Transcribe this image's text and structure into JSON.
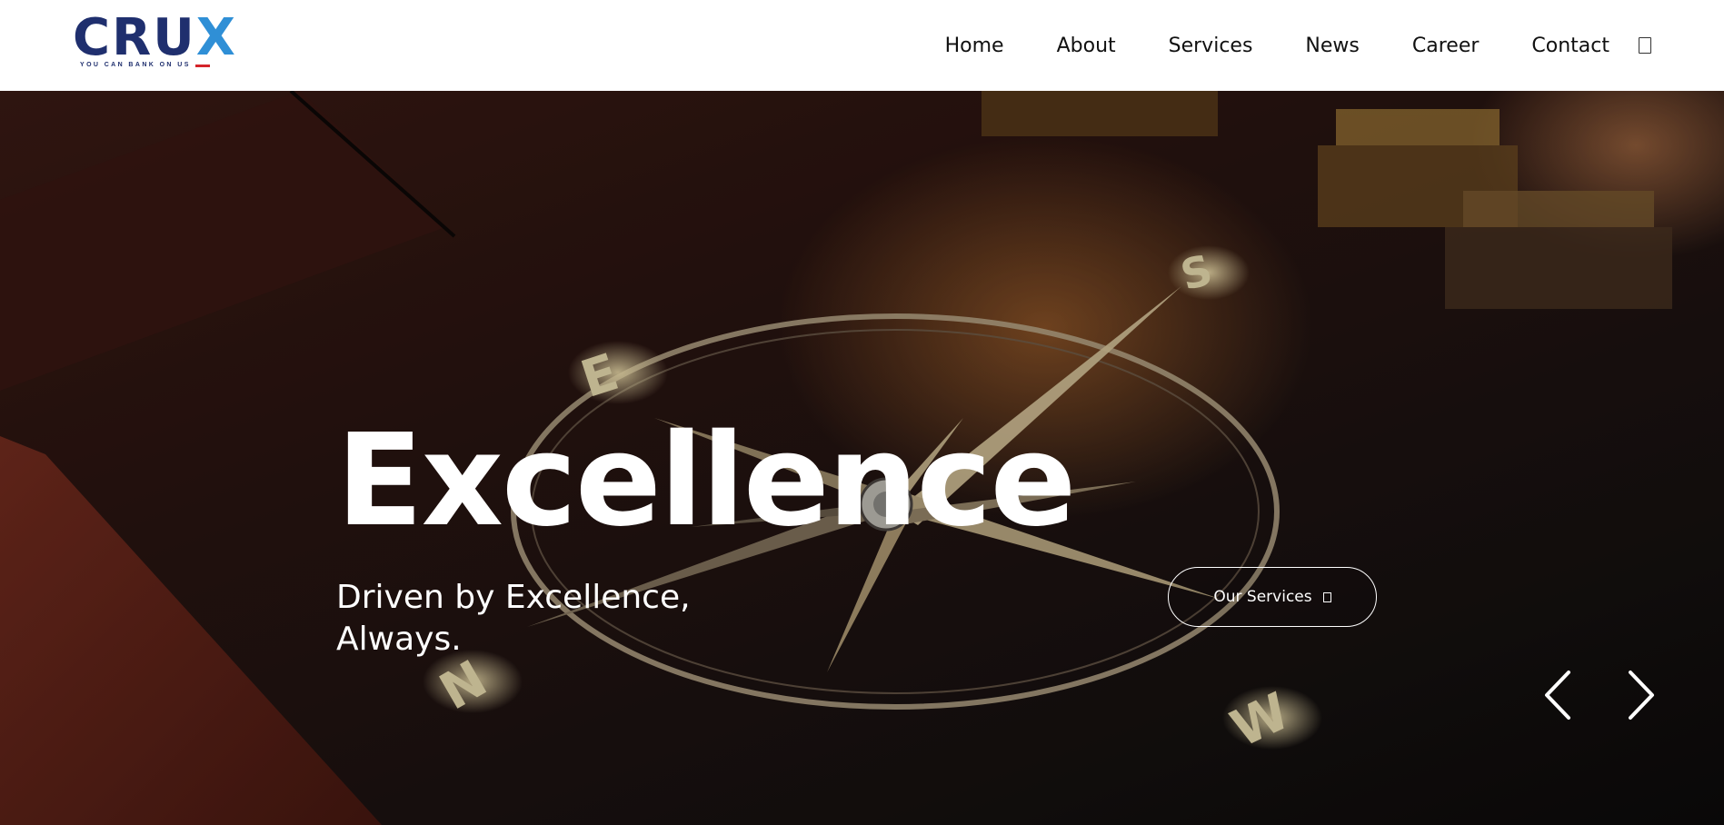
{
  "brand": {
    "logo_text": "CRU",
    "logo_accent": "X",
    "tagline": "YOU CAN BANK ON US",
    "primary_color": "#1f2f6e",
    "accent_color": "#2f8fd6",
    "flag_color": "#d4242a"
  },
  "nav": {
    "items": [
      "Home",
      "About",
      "Services",
      "News",
      "Career",
      "Contact"
    ],
    "trailing_icon": "search-icon"
  },
  "hero": {
    "headline": "Excellence",
    "subline": "Driven by Excellence, Always.",
    "cta_label": "Our Services",
    "cta_icon": "arrow-box-icon",
    "prev_icon": "chevron-left-icon",
    "next_icon": "chevron-right-icon",
    "background_image": "compass-on-wooden-desk",
    "compass_letters": [
      "E",
      "S",
      "N",
      "W"
    ]
  }
}
